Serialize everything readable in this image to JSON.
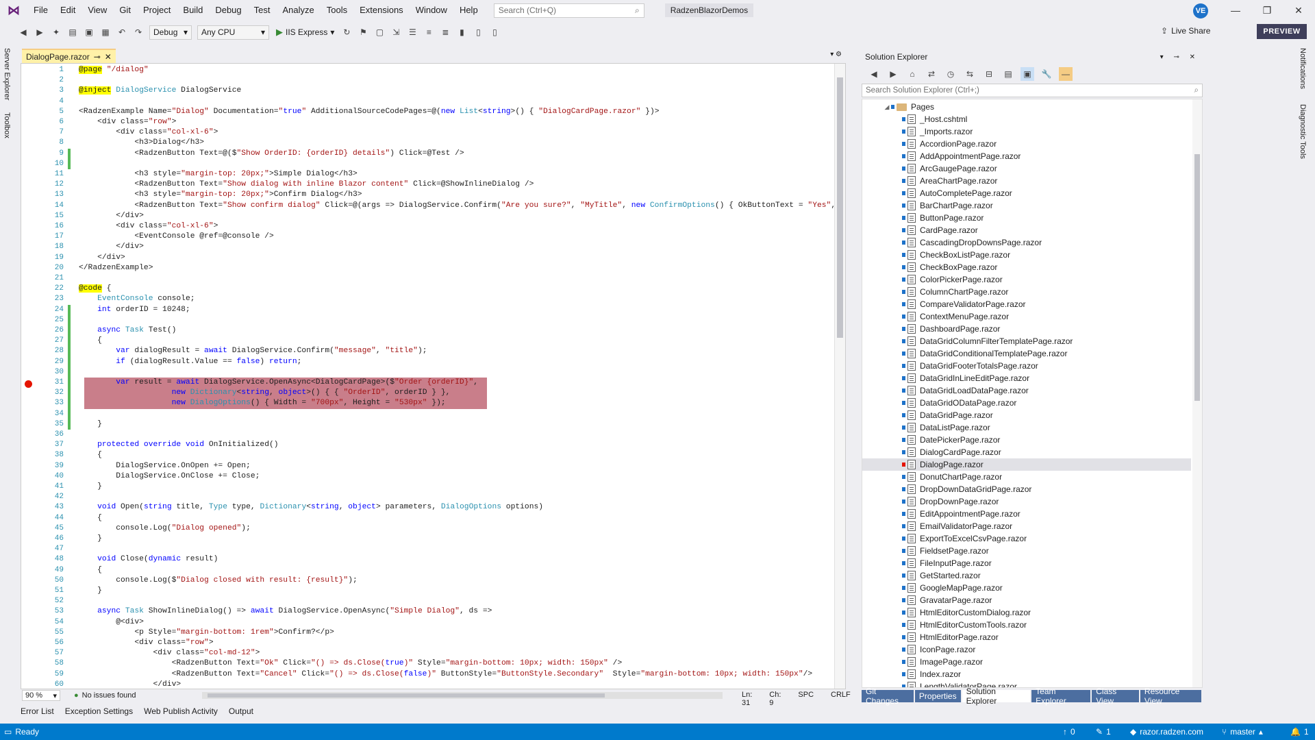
{
  "titlebar": {
    "menu": [
      "File",
      "Edit",
      "View",
      "Git",
      "Project",
      "Build",
      "Debug",
      "Test",
      "Analyze",
      "Tools",
      "Extensions",
      "Window",
      "Help"
    ],
    "search_placeholder": "Search (Ctrl+Q)",
    "project_name": "RadzenBlazorDemos",
    "user_initials": "VE"
  },
  "toolbar": {
    "config": "Debug",
    "platform": "Any CPU",
    "run_target": "IIS Express",
    "live_share": "Live Share",
    "preview": "PREVIEW"
  },
  "left_strip": {
    "server_explorer": "Server Explorer",
    "toolbox": "Toolbox"
  },
  "right_strip": {
    "notifications": "Notifications",
    "diagnostic_tools": "Diagnostic Tools"
  },
  "editor": {
    "tab_name": "DialogPage.razor",
    "line_numbers": [
      "1",
      "2",
      "3",
      "4",
      "5",
      "6",
      "7",
      "8",
      "9",
      "10",
      "11",
      "12",
      "13",
      "14",
      "15",
      "16",
      "17",
      "18",
      "19",
      "20",
      "21",
      "22",
      "23",
      "24",
      "25",
      "26",
      "27",
      "28",
      "29",
      "30",
      "31",
      "32",
      "33",
      "34",
      "35",
      "36",
      "37",
      "38",
      "39",
      "40",
      "41",
      "42",
      "43",
      "44",
      "45",
      "46",
      "47",
      "48",
      "49",
      "50",
      "51",
      "52",
      "53",
      "54",
      "55",
      "56",
      "57",
      "58",
      "59",
      "60"
    ],
    "lines": [
      "@page \"/dialog\"",
      "",
      "@inject DialogService DialogService",
      "",
      "<RadzenExample Name=\"Dialog\" Documentation=\"true\" AdditionalSourceCodePages=@(new List<string>() { \"DialogCardPage.razor\" })>",
      "    <div class=\"row\">",
      "        <div class=\"col-xl-6\">",
      "            <h3>Dialog</h3>",
      "            <RadzenButton Text=@($\"Show OrderID: {orderID} details\") Click=@Test />",
      "",
      "            <h3 style=\"margin-top: 20px;\">Simple Dialog</h3>",
      "            <RadzenButton Text=\"Show dialog with inline Blazor content\" Click=@ShowInlineDialog />",
      "            <h3 style=\"margin-top: 20px;\">Confirm Dialog</h3>",
      "            <RadzenButton Text=\"Show confirm dialog\" Click=@(args => DialogService.Confirm(\"Are you sure?\", \"MyTitle\", new ConfirmOptions() { OkButtonText = \"Yes\", CancelButt",
      "        </div>",
      "        <div class=\"col-xl-6\">",
      "            <EventConsole @ref=@console />",
      "        </div>",
      "    </div>",
      "</RadzenExample>",
      "",
      "@code {",
      "    EventConsole console;",
      "    int orderID = 10248;",
      "",
      "    async Task Test()",
      "    {",
      "        var dialogResult = await DialogService.Confirm(\"message\", \"title\");",
      "        if (dialogResult.Value == false) return;",
      "",
      "        var result = await DialogService.OpenAsync<DialogCardPage>($\"Order {orderID}\",",
      "                    new Dictionary<string, object>() { { \"OrderID\", orderID } },",
      "                    new DialogOptions() { Width = \"700px\", Height = \"530px\" });",
      "",
      "    }",
      "",
      "    protected override void OnInitialized()",
      "    {",
      "        DialogService.OnOpen += Open;",
      "        DialogService.OnClose += Close;",
      "    }",
      "",
      "    void Open(string title, Type type, Dictionary<string, object> parameters, DialogOptions options)",
      "    {",
      "        console.Log(\"Dialog opened\");",
      "    }",
      "",
      "    void Close(dynamic result)",
      "    {",
      "        console.Log($\"Dialog closed with result: {result}\");",
      "    }",
      "",
      "    async Task ShowInlineDialog() => await DialogService.OpenAsync(\"Simple Dialog\", ds =>",
      "        @<div>",
      "            <p Style=\"margin-bottom: 1rem\">Confirm?</p>",
      "            <div class=\"row\">",
      "                <div class=\"col-md-12\">",
      "                    <RadzenButton Text=\"Ok\" Click=\"() => ds.Close(true)\" Style=\"margin-bottom: 10px; width: 150px\" />",
      "                    <RadzenButton Text=\"Cancel\" Click=\"() => ds.Close(false)\" ButtonStyle=\"ButtonStyle.Secondary\"  Style=\"margin-bottom: 10px; width: 150px\"/>",
      "                </div>"
    ]
  },
  "editor_status": {
    "zoom": "90 %",
    "issues": "No issues found",
    "ln": "Ln: 31",
    "ch": "Ch: 9",
    "spc": "SPC",
    "crlf": "CRLF"
  },
  "bottom_tabs": [
    "Error List",
    "Exception Settings",
    "Web Publish Activity",
    "Output"
  ],
  "solution_explorer": {
    "title": "Solution Explorer",
    "search_placeholder": "Search Solution Explorer (Ctrl+;)",
    "folder": "Pages",
    "selected": "DialogPage.razor",
    "files": [
      "_Host.cshtml",
      "_Imports.razor",
      "AccordionPage.razor",
      "AddAppointmentPage.razor",
      "ArcGaugePage.razor",
      "AreaChartPage.razor",
      "AutoCompletePage.razor",
      "BarChartPage.razor",
      "ButtonPage.razor",
      "CardPage.razor",
      "CascadingDropDownsPage.razor",
      "CheckBoxListPage.razor",
      "CheckBoxPage.razor",
      "ColorPickerPage.razor",
      "ColumnChartPage.razor",
      "CompareValidatorPage.razor",
      "ContextMenuPage.razor",
      "DashboardPage.razor",
      "DataGridColumnFilterTemplatePage.razor",
      "DataGridConditionalTemplatePage.razor",
      "DataGridFooterTotalsPage.razor",
      "DataGridInLineEditPage.razor",
      "DataGridLoadDataPage.razor",
      "DataGridODataPage.razor",
      "DataGridPage.razor",
      "DataListPage.razor",
      "DatePickerPage.razor",
      "DialogCardPage.razor",
      "DialogPage.razor",
      "DonutChartPage.razor",
      "DropDownDataGridPage.razor",
      "DropDownPage.razor",
      "EditAppointmentPage.razor",
      "EmailValidatorPage.razor",
      "ExportToExcelCsvPage.razor",
      "FieldsetPage.razor",
      "FileInputPage.razor",
      "GetStarted.razor",
      "GoogleMapPage.razor",
      "GravatarPage.razor",
      "HtmlEditorCustomDialog.razor",
      "HtmlEditorCustomTools.razor",
      "HtmlEditorPage.razor",
      "IconPage.razor",
      "ImagePage.razor",
      "Index.razor",
      "LengthValidatorPage.razor"
    ],
    "tabs": [
      "Git Changes",
      "Properties",
      "Solution Explorer",
      "Team Explorer",
      "Class View",
      "Resource View"
    ],
    "active_tab": "Solution Explorer"
  },
  "statusbar": {
    "ready": "Ready",
    "up_count": "0",
    "edit_count": "1",
    "remote": "razor.radzen.com",
    "branch": "master",
    "notif": "1"
  }
}
